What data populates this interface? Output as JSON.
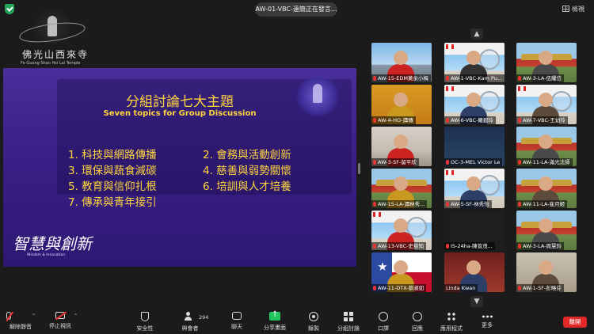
{
  "window": {
    "title": "AW-01-VBC-遠簡正在發言...",
    "view_button": "檢視"
  },
  "temple_logo": {
    "name_cn": "佛光山西來寺",
    "name_en": "Fo Guang Shan Hsi Lai Temple"
  },
  "slide": {
    "title": "分組討論七大主題",
    "subtitle": "Seven topics for Group Discussion",
    "topics": [
      "1. 科技與網路傳播",
      "2. 會務與活動創新",
      "3. 環保與蔬食減碳",
      "4. 慈善與弱勢關懷",
      "5. 教育與信仰扎根",
      "6. 培訓與人才培養",
      "7. 傳承與青年接引"
    ],
    "slogan": "智慧與創新",
    "slogan_en": "Wisdom & Innovation"
  },
  "gallery": {
    "participants": [
      {
        "label": "AW-15-EDM黃余小梅",
        "scene": "sky",
        "muted": true
      },
      {
        "label": "AW-1-VBC-Kam Pu...",
        "scene": "banner",
        "muted": true
      },
      {
        "label": "AW-3-LA-伍耀信",
        "scene": "temple",
        "muted": true
      },
      {
        "label": "AW-4-HO-譚傳",
        "scene": "yellow",
        "muted": true
      },
      {
        "label": "AW-6-VBC-羅碧玲",
        "scene": "banner",
        "muted": true
      },
      {
        "label": "AW-7-VBC-王幼玲",
        "scene": "banner",
        "muted": true
      },
      {
        "label": "AW-3-SF-留平欣",
        "scene": "room",
        "muted": true
      },
      {
        "label": "OC-3-MEL Victor Le",
        "scene": "dark",
        "muted": true
      },
      {
        "label": "AW-11-LA-滿光法師",
        "scene": "temple",
        "muted": true
      },
      {
        "label": "AW-15-LA-譚林秀...",
        "scene": "temple",
        "muted": true
      },
      {
        "label": "AW-5-SF-林秀怡",
        "scene": "banner",
        "muted": true
      },
      {
        "label": "AW-11-LA-崔月姬",
        "scene": "temple",
        "muted": true
      },
      {
        "label": "AW-13-VBC-史慈知",
        "scene": "banner",
        "muted": true
      },
      {
        "label": "IS-24ha-陳曾茂...",
        "scene": "black",
        "muted": true
      },
      {
        "label": "AW-3-LA-周慧鈴",
        "scene": "temple",
        "muted": true
      },
      {
        "label": "AW-11-DTX-蔡淑如",
        "scene": "flag",
        "muted": true
      },
      {
        "label": "Linda Kwan",
        "scene": "redroom",
        "muted": false
      },
      {
        "label": "AW-1-SF-彭曉芬",
        "scene": "gold",
        "muted": true
      }
    ]
  },
  "toolbar": {
    "mute": "解除靜音",
    "video": "停止視訊",
    "security": "安全性",
    "participants": "與會者",
    "participants_count": "294",
    "chat": "聊天",
    "share": "分享畫面",
    "record": "錄製",
    "breakout": "分組討論",
    "interpretation": "口譯",
    "reactions": "回應",
    "apps": "應用程式",
    "more": "更多",
    "leave": "離開"
  },
  "colors": {
    "background": "#1b1b1b",
    "slide_text": "#ffd53d",
    "share_accent": "#23c55e",
    "leave_red": "#e02828"
  }
}
